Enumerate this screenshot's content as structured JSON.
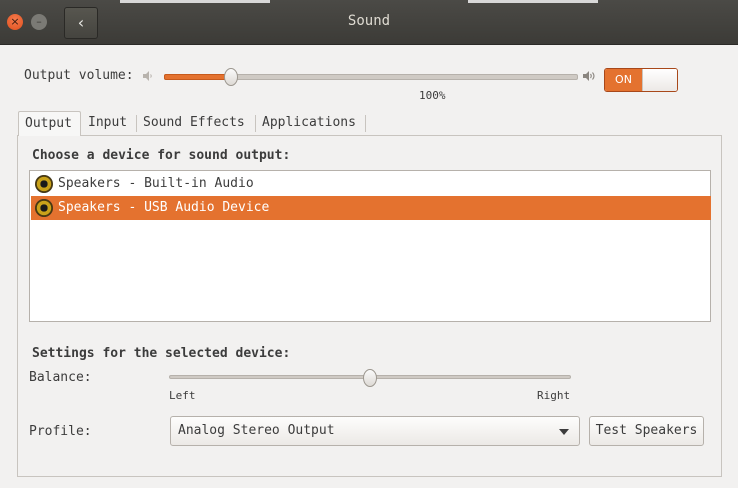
{
  "window": {
    "title": "Sound",
    "close_glyph": "×",
    "minimize_glyph": "–",
    "back_glyph": "‹"
  },
  "output_volume": {
    "label": "Output volume:",
    "value_text": "100%",
    "level": 0.16,
    "switch_label": "ON",
    "switch_on": true,
    "icons": {
      "min": "speaker-quiet-icon",
      "max": "speaker-loud-icon"
    }
  },
  "tabs": [
    {
      "label": "Output",
      "active": true
    },
    {
      "label": "Input",
      "active": false
    },
    {
      "label": "Sound Effects",
      "active": false
    },
    {
      "label": "Applications",
      "active": false
    }
  ],
  "output_panel": {
    "heading": "Choose a device for sound output:",
    "devices": [
      {
        "label": "Speakers - Built-in Audio",
        "selected": false,
        "icon": "speaker-device-icon"
      },
      {
        "label": "Speakers - USB Audio Device",
        "selected": true,
        "icon": "speaker-device-icon"
      }
    ],
    "settings_heading": "Settings for the selected device:",
    "balance": {
      "label": "Balance:",
      "left_label": "Left",
      "right_label": "Right",
      "position": 0.5
    },
    "profile": {
      "label": "Profile:",
      "value": "Analog Stereo Output"
    },
    "test_button": "Test Speakers"
  },
  "colors": {
    "accent": "#e4722f",
    "titlebar": "#3c3b37",
    "background": "#f2f1f0"
  }
}
